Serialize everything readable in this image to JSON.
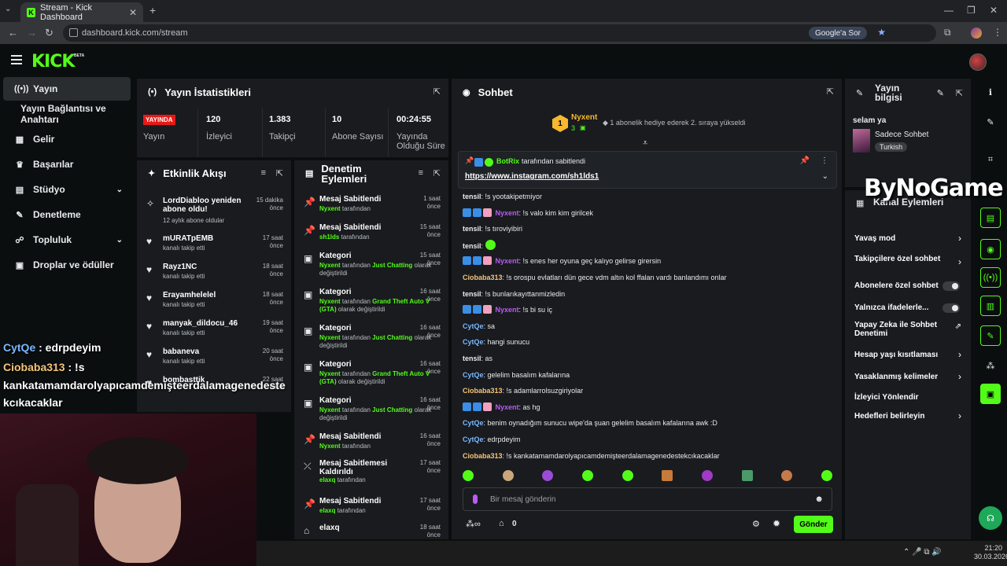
{
  "browser": {
    "tab_title": "Stream - Kick Dashboard",
    "url": "dashboard.kick.com/stream",
    "google_ask": "Google'a Sor"
  },
  "header": {
    "logo": "KICK",
    "beta": "BETA"
  },
  "nav": {
    "items": [
      {
        "label": "Yayın",
        "icon": "broadcast-icon"
      },
      {
        "label": "Yayın Bağlantısı ve Anahtarı"
      },
      {
        "label": "Gelir",
        "icon": "chart-icon"
      },
      {
        "label": "Başarılar",
        "icon": "trophy-icon"
      },
      {
        "label": "Stüdyo",
        "icon": "studio-icon"
      },
      {
        "label": "Denetleme",
        "icon": "wrench-icon"
      },
      {
        "label": "Topluluk",
        "icon": "community-icon"
      },
      {
        "label": "Droplar ve ödüller",
        "icon": "gift-icon"
      }
    ]
  },
  "stats": {
    "title": "Yayın İstatistikleri",
    "live": "YAYINDA",
    "items": [
      {
        "value": "",
        "label": "Yayın"
      },
      {
        "value": "120",
        "label": "İzleyici"
      },
      {
        "value": "1.383",
        "label": "Takipçi"
      },
      {
        "value": "10",
        "label": "Abone Sayısı"
      },
      {
        "value": "00:24:55",
        "label": "Yayında Olduğu Süre"
      }
    ]
  },
  "activity": {
    "title": "Etkinlik Akışı",
    "items": [
      {
        "name": "LordDiabloo yeniden abone oldu!",
        "sub": "12 aylık abone oldular",
        "time": "15 dakika önce"
      },
      {
        "name": "mURATpEMB",
        "sub": "kanalı takip etti",
        "time": "17 saat önce"
      },
      {
        "name": "Rayz1NC",
        "sub": "kanalı takip etti",
        "time": "18 saat önce"
      },
      {
        "name": "Erayamhelelel",
        "sub": "kanalı takip etti",
        "time": "18 saat önce"
      },
      {
        "name": "manyak_dildocu_46",
        "sub": "kanalı takip etti",
        "time": "19 saat önce"
      },
      {
        "name": "babaneva",
        "sub": "kanalı takip etti",
        "time": "20 saat önce"
      },
      {
        "name": "bombasttik",
        "sub": "",
        "time": "22 saat önce"
      }
    ]
  },
  "mod": {
    "title": "Denetim Eylemleri",
    "items": [
      {
        "title": "Mesaj Sabitlendi",
        "user": "Nyxent",
        "rest": " tarafından",
        "time": "1 saat önce"
      },
      {
        "title": "Mesaj Sabitlendi",
        "user": "sh1lds",
        "rest": " tarafından",
        "time": "15 saat önce"
      },
      {
        "title": "Kategori",
        "user": "Nyxent",
        "rest": " tarafından ",
        "cat": "Just Chatting",
        "rest2": " olarak değiştirildi",
        "time": "15 saat önce"
      },
      {
        "title": "Kategori",
        "user": "Nyxent",
        "rest": " tarafından ",
        "cat": "Grand Theft Auto V (GTA)",
        "rest2": " olarak değiştirildi",
        "time": "16 saat önce"
      },
      {
        "title": "Kategori",
        "user": "Nyxent",
        "rest": " tarafından ",
        "cat": "Just Chatting",
        "rest2": " olarak değiştirildi",
        "time": "16 saat önce"
      },
      {
        "title": "Kategori",
        "user": "Nyxent",
        "rest": " tarafından ",
        "cat": "Grand Theft Auto V (GTA)",
        "rest2": " olarak değiştirildi",
        "time": "16 saat önce"
      },
      {
        "title": "Kategori",
        "user": "Nyxent",
        "rest": " tarafından ",
        "cat": "Just Chatting",
        "rest2": " olarak değiştirildi",
        "time": "16 saat önce"
      },
      {
        "title": "Mesaj Sabitlendi",
        "user": "Nyxent",
        "rest": " tarafından",
        "time": "16 saat önce"
      },
      {
        "title": "Mesaj Sabitlemesi Kaldırıldı",
        "user": "elaxq",
        "rest": " tarafından",
        "time": "17 saat önce"
      },
      {
        "title": "Mesaj Sabitlendi",
        "user": "elaxq",
        "rest": " tarafından",
        "time": "17 saat önce"
      },
      {
        "title": "elaxq",
        "user": "",
        "rest": "",
        "time": "18 saat önce"
      }
    ]
  },
  "chat": {
    "title": "Sohbet",
    "gift_user": "Nyxent",
    "gift_rank": "1",
    "gift_count": "3",
    "gift_text": "1 abonelik hediye ederek 2. sıraya yükseldi",
    "pinned_by": "BotRix",
    "pinned_suffix": "tarafından sabitlendi",
    "pinned_link": "https://www.instagram.com/sh1lds1",
    "messages": [
      {
        "user": "tensil",
        "cls": "u-tensil",
        "badges": false,
        "text": "!s yootakipetmiyor"
      },
      {
        "user": "Nyxent",
        "cls": "u-nyx",
        "badges": true,
        "text": "!s valo kim kim girilcek"
      },
      {
        "user": "tensil",
        "cls": "u-tensil",
        "badges": false,
        "text": "!s tıroviyibiri"
      },
      {
        "user": "tensil",
        "cls": "u-tensil",
        "badges": false,
        "text": "",
        "emote": true
      },
      {
        "user": "Nyxent",
        "cls": "u-nyx",
        "badges": true,
        "text": "!s enes her oyuna geç kalıyo gelirse girersin"
      },
      {
        "user": "Ciobaba313",
        "cls": "u-ciob",
        "badges": false,
        "text": "!s orospu evlatları dün gece vdm altın kol ffalan vardı banlandımı onlar"
      },
      {
        "user": "tensil",
        "cls": "u-tensil",
        "badges": false,
        "text": "!s bunlarıkayıttanmizledin"
      },
      {
        "user": "Nyxent",
        "cls": "u-nyx",
        "badges": true,
        "text": "!s bi su iç"
      },
      {
        "user": "CytQe",
        "cls": "u-cytqe",
        "badges": false,
        "text": "sa"
      },
      {
        "user": "CytQe",
        "cls": "u-cytqe",
        "badges": false,
        "text": "hangi sunucu"
      },
      {
        "user": "tensil",
        "cls": "u-tensil",
        "badges": false,
        "text": "as"
      },
      {
        "user": "CytQe",
        "cls": "u-cytqe",
        "badges": false,
        "text": "gelelim basalım kafalarına"
      },
      {
        "user": "Ciobaba313",
        "cls": "u-ciob",
        "badges": false,
        "text": "!s adamlarrolsuzgiriyolar"
      },
      {
        "user": "Nyxent",
        "cls": "u-nyx",
        "badges": true,
        "text": "as hg"
      },
      {
        "user": "CytQe",
        "cls": "u-cytqe",
        "badges": false,
        "text": "benim oynadığım sunucu wipe'da şuan gelelim basalım kafalarına awk :D"
      },
      {
        "user": "CytQe",
        "cls": "u-cytqe",
        "badges": false,
        "text": "edrpdeyim"
      },
      {
        "user": "Ciobaba313",
        "cls": "u-ciob",
        "badges": false,
        "text": "!s kankatamamdarolyapıcamdemişteerdalamagenedestekcıkacaklar"
      }
    ],
    "input_placeholder": "Bir mesaj gönderin",
    "send_label": "Gönder",
    "store_count": "0"
  },
  "info": {
    "title_line1": "Yayın",
    "title_line2": "bilgisi",
    "stream_title": "selam ya",
    "category": "Sadece Sohbet",
    "tag": "Turkish",
    "actions_title": "Kanal Eylemleri",
    "rows": [
      {
        "label": "Yavaş mod",
        "ctl": "chevron"
      },
      {
        "label": "Takipçilere özel sohbet",
        "ctl": "chevron"
      },
      {
        "label": "Abonelere özel sohbet",
        "ctl": "toggle"
      },
      {
        "label": "Yalnızca ifadelerle...",
        "ctl": "toggle"
      },
      {
        "label": "Yapay Zeka ile Sohbet Denetimi",
        "ctl": "external"
      },
      {
        "label": "Hesap yaşı kısıtlaması",
        "ctl": "chevron"
      },
      {
        "label": "Yasaklanmış kelimeler",
        "ctl": "chevron"
      },
      {
        "label": "İzleyici Yönlendir",
        "ctl": "none"
      },
      {
        "label": "Hedefleri belirleyin",
        "ctl": "chevron"
      }
    ]
  },
  "overlay": {
    "line1_user": "CytQe",
    "line1_text": " : edrpdeyim",
    "line2_user": "Ciobaba313",
    "line2_text": " : !s",
    "line3": "kankatamamdarolyapıcamdemişteerdalamagenedeste",
    "line4": "kcıkacaklar",
    "watermark": "ByNoGame"
  },
  "taskbar": {
    "time": "21:20",
    "date": "30.03.2026"
  },
  "colors": {
    "accent": "#53fc18",
    "panel": "#191b1f",
    "live": "#e91916"
  }
}
